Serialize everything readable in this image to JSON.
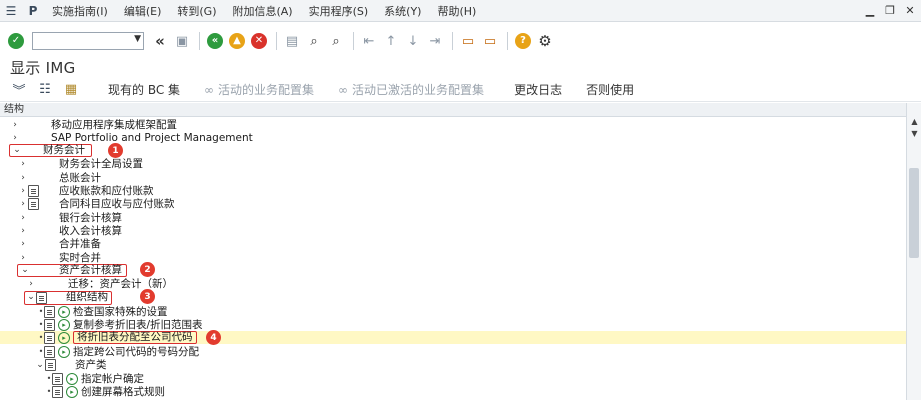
{
  "menubar": {
    "items": [
      "实施指南(I)",
      "编辑(E)",
      "转到(G)",
      "附加信息(A)",
      "实用程序(S)",
      "系统(Y)",
      "帮助(H)"
    ]
  },
  "toolbar": {
    "command_value": ""
  },
  "title": "显示 IMG",
  "app_toolbar": {
    "buttons": [
      "现有的 BC 集",
      "活动的业务配置集",
      "活动已激活的业务配置集",
      "更改日志",
      "否则使用"
    ]
  },
  "tree": {
    "header": "结构",
    "rows": [
      {
        "label": "移动应用程序集成框架配置"
      },
      {
        "label": "SAP Portfolio and Project Management"
      },
      {
        "label": "财务会计"
      },
      {
        "label": "财务会计全局设置"
      },
      {
        "label": "总账会计"
      },
      {
        "label": "应收账款和应付账款"
      },
      {
        "label": "合同科目应收与应付账款"
      },
      {
        "label": "银行会计核算"
      },
      {
        "label": "收入会计核算"
      },
      {
        "label": "合并准备"
      },
      {
        "label": "实时合并"
      },
      {
        "label": "资产会计核算"
      },
      {
        "label": "迁移：资产会计（新）"
      },
      {
        "label": "组织结构"
      },
      {
        "label": "检查国家特殊的设置"
      },
      {
        "label": "复制参考折旧表/折旧范围表"
      },
      {
        "label": "将折旧表分配至公司代码"
      },
      {
        "label": "指定跨公司代码的号码分配"
      },
      {
        "label": "资产类"
      },
      {
        "label": "指定帐户确定"
      },
      {
        "label": "创建屏幕格式规则"
      }
    ],
    "markers": [
      "1",
      "2",
      "3",
      "4"
    ]
  },
  "colors": {
    "highlight": "#fff8c4",
    "annotation_red": "#e23b2e"
  }
}
